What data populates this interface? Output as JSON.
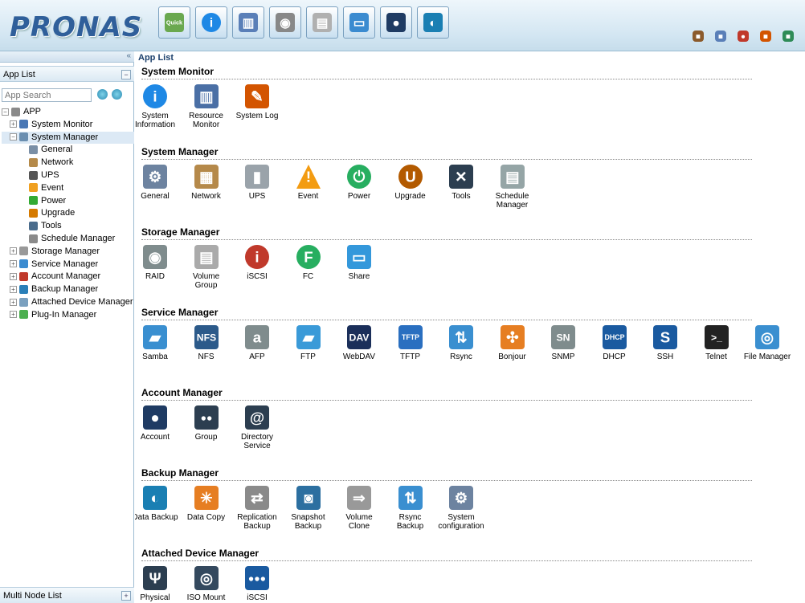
{
  "header": {
    "logo": "PRONAS",
    "toolbar": [
      {
        "name": "quick",
        "label": "Quick",
        "icon": "quick-icon",
        "color": "#6aa84f"
      },
      {
        "name": "info",
        "label": "",
        "icon": "info-icon",
        "color": "#1e88e5"
      },
      {
        "name": "resource",
        "label": "",
        "icon": "bar-chart-icon",
        "color": "#5a7fb8"
      },
      {
        "name": "raid",
        "label": "",
        "icon": "disk-icon",
        "color": "#888888"
      },
      {
        "name": "volume",
        "label": "",
        "icon": "volume-icon",
        "color": "#b0b0b0"
      },
      {
        "name": "share",
        "label": "",
        "icon": "share-icon",
        "color": "#3b8bd0"
      },
      {
        "name": "account",
        "label": "",
        "icon": "user-icon",
        "color": "#1f3b63"
      },
      {
        "name": "backup",
        "label": "",
        "icon": "backup-icon",
        "color": "#1a7fb3"
      }
    ],
    "right_icons": [
      "monitor-icon",
      "folder-icon",
      "user-icon",
      "home-icon",
      "logout-icon"
    ]
  },
  "sidebar": {
    "collapse": "«",
    "title": "App List",
    "title_button": "−",
    "search_placeholder": "App Search",
    "tree": [
      {
        "label": "APP",
        "level": 0,
        "toggle": "−",
        "icon": "app-icon",
        "color": "#8a8a8a"
      },
      {
        "label": "System Monitor",
        "level": 1,
        "toggle": "+",
        "icon": "monitor-icon",
        "color": "#4a78b5"
      },
      {
        "label": "System Manager",
        "level": 1,
        "toggle": "−",
        "icon": "system-icon",
        "color": "#6b8fb0",
        "selected": true
      },
      {
        "label": "General",
        "level": 2,
        "icon": "gear-icon",
        "color": "#7a8fa6"
      },
      {
        "label": "Network",
        "level": 2,
        "icon": "network-icon",
        "color": "#b58a4a"
      },
      {
        "label": "UPS",
        "level": 2,
        "icon": "ups-icon",
        "color": "#555555"
      },
      {
        "label": "Event",
        "level": 2,
        "icon": "warning-icon",
        "color": "#f0a020"
      },
      {
        "label": "Power",
        "level": 2,
        "icon": "power-icon",
        "color": "#33aa33"
      },
      {
        "label": "Upgrade",
        "level": 2,
        "icon": "upgrade-icon",
        "color": "#d57a00"
      },
      {
        "label": "Tools",
        "level": 2,
        "icon": "tools-icon",
        "color": "#4a6c8c"
      },
      {
        "label": "Schedule Manager",
        "level": 2,
        "icon": "calendar-icon",
        "color": "#8a8a8a"
      },
      {
        "label": "Storage Manager",
        "level": 1,
        "toggle": "+",
        "icon": "storage-icon",
        "color": "#999999"
      },
      {
        "label": "Service Manager",
        "level": 1,
        "toggle": "+",
        "icon": "service-icon",
        "color": "#3b8bd0"
      },
      {
        "label": "Account Manager",
        "level": 1,
        "toggle": "+",
        "icon": "account-icon",
        "color": "#c0392b"
      },
      {
        "label": "Backup Manager",
        "level": 1,
        "toggle": "+",
        "icon": "backup-icon",
        "color": "#2a7fb8"
      },
      {
        "label": "Attached Device Manager",
        "level": 1,
        "toggle": "+",
        "icon": "usb-icon",
        "color": "#7aa0bf"
      },
      {
        "label": "Plug-In Manager",
        "level": 1,
        "toggle": "+",
        "icon": "plugin-icon",
        "color": "#4caf50"
      }
    ],
    "bottom": {
      "label": "Multi Node List",
      "button": "+"
    }
  },
  "main": {
    "title": "App List",
    "sections": [
      {
        "title": "System Monitor",
        "apps": [
          {
            "label": "System Information",
            "icon": "info-icon",
            "color": "#1e88e5"
          },
          {
            "label": "Resource Monitor",
            "icon": "bar-chart-icon",
            "color": "#4a6fa5"
          },
          {
            "label": "System Log",
            "icon": "log-icon",
            "color": "#d35400"
          }
        ]
      },
      {
        "title": "System Manager",
        "apps": [
          {
            "label": "General",
            "icon": "gear-icon",
            "color": "#6d83a0"
          },
          {
            "label": "Network",
            "icon": "network-icon",
            "color": "#b5894a"
          },
          {
            "label": "UPS",
            "icon": "ups-icon",
            "color": "#9aa3aa"
          },
          {
            "label": "Event",
            "icon": "warning-icon",
            "color": "#f39c12"
          },
          {
            "label": "Power",
            "icon": "power-icon",
            "color": "#27ae60"
          },
          {
            "label": "Upgrade",
            "icon": "upgrade-icon",
            "color": "#b35a00"
          },
          {
            "label": "Tools",
            "icon": "tools-icon",
            "color": "#2c3e50"
          },
          {
            "label": "Schedule Manager",
            "icon": "calendar-icon",
            "color": "#95a5a6"
          }
        ]
      },
      {
        "title": "Storage Manager",
        "apps": [
          {
            "label": "RAID",
            "icon": "disk-icon",
            "color": "#7f8c8d"
          },
          {
            "label": "Volume Group",
            "icon": "volume-icon",
            "color": "#aaaaaa"
          },
          {
            "label": "iSCSI",
            "icon": "iscsi-icon",
            "color": "#c0392b"
          },
          {
            "label": "FC",
            "icon": "fc-icon",
            "color": "#27ae60"
          },
          {
            "label": "Share",
            "icon": "share-icon",
            "color": "#3498db"
          }
        ]
      },
      {
        "title": "Service Manager",
        "apps": [
          {
            "label": "Samba",
            "icon": "samba-icon",
            "color": "#3a8fd0"
          },
          {
            "label": "NFS",
            "icon": "nfs-icon",
            "color": "#2c5a8a"
          },
          {
            "label": "AFP",
            "icon": "apple-icon",
            "color": "#7f8c8d"
          },
          {
            "label": "FTP",
            "icon": "ftp-icon",
            "color": "#3a9ad8"
          },
          {
            "label": "WebDAV",
            "icon": "webdav-icon",
            "color": "#1b2f5a"
          },
          {
            "label": "TFTP",
            "icon": "tftp-icon",
            "color": "#2a6fc0"
          },
          {
            "label": "Rsync",
            "icon": "rsync-icon",
            "color": "#3a8fd0"
          },
          {
            "label": "Bonjour",
            "icon": "bonjour-icon",
            "color": "#e67e22"
          },
          {
            "label": "SNMP",
            "icon": "snmp-icon",
            "color": "#7f8c8d"
          },
          {
            "label": "DHCP",
            "icon": "dhcp-icon",
            "color": "#1a5aa0"
          },
          {
            "label": "SSH",
            "icon": "ssh-icon",
            "color": "#1a5aa0"
          },
          {
            "label": "Telnet",
            "icon": "terminal-icon",
            "color": "#222222"
          },
          {
            "label": "File Manager",
            "icon": "file-manager-icon",
            "color": "#3a8fd0"
          }
        ]
      },
      {
        "title": "Account Manager",
        "apps": [
          {
            "label": "Account",
            "icon": "user-icon",
            "color": "#1f3b63"
          },
          {
            "label": "Group",
            "icon": "group-icon",
            "color": "#2c3e50"
          },
          {
            "label": "Directory Service",
            "icon": "directory-icon",
            "color": "#2c3e50"
          }
        ]
      },
      {
        "title": "Backup Manager",
        "apps": [
          {
            "label": "Data Backup",
            "icon": "backup-icon",
            "color": "#1a7fb3"
          },
          {
            "label": "Data Copy",
            "icon": "data-copy-icon",
            "color": "#e67e22"
          },
          {
            "label": "Replication Backup",
            "icon": "replication-icon",
            "color": "#8a8a8a"
          },
          {
            "label": "Snapshot Backup",
            "icon": "snapshot-icon",
            "color": "#2c6fa0"
          },
          {
            "label": "Volume Clone",
            "icon": "clone-icon",
            "color": "#999999"
          },
          {
            "label": "Rsync Backup",
            "icon": "rsync-icon",
            "color": "#3a8fd0"
          },
          {
            "label": "System configuration",
            "icon": "gear-icon",
            "color": "#6d83a0"
          }
        ]
      },
      {
        "title": "Attached Device Manager",
        "apps": [
          {
            "label": "Physical",
            "icon": "usb-icon",
            "color": "#2c3e50"
          },
          {
            "label": "ISO Mount",
            "icon": "iso-icon",
            "color": "#34495e"
          },
          {
            "label": "iSCSI",
            "icon": "iscsi-target-icon",
            "color": "#1a5aa0"
          }
        ]
      }
    ]
  }
}
